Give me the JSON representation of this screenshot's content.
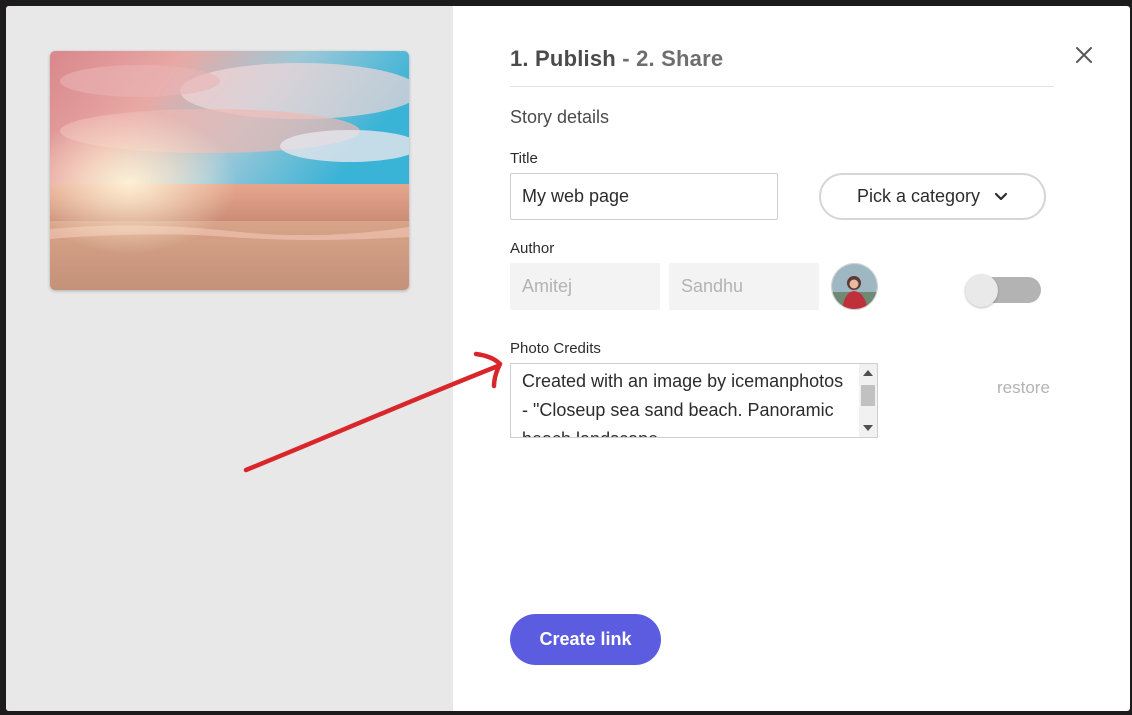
{
  "header": {
    "step1": "1. Publish",
    "separator": " - ",
    "step2": "2. Share"
  },
  "section_title": "Story details",
  "title_field": {
    "label": "Title",
    "value": "My web page"
  },
  "category": {
    "label": "Pick a category",
    "icon": "chevron-down-icon"
  },
  "author": {
    "label": "Author",
    "first_name": "Amitej",
    "last_name": "Sandhu",
    "toggle_on": false
  },
  "photo_credits": {
    "label": "Photo Credits",
    "value": "Created with an image by icemanphotos - \"Closeup sea sand beach. Panoramic beach landscape."
  },
  "restore_label": "restore",
  "create_link_label": "Create link",
  "colors": {
    "accent": "#5c5ce0",
    "annotation_arrow": "#d9262b"
  }
}
